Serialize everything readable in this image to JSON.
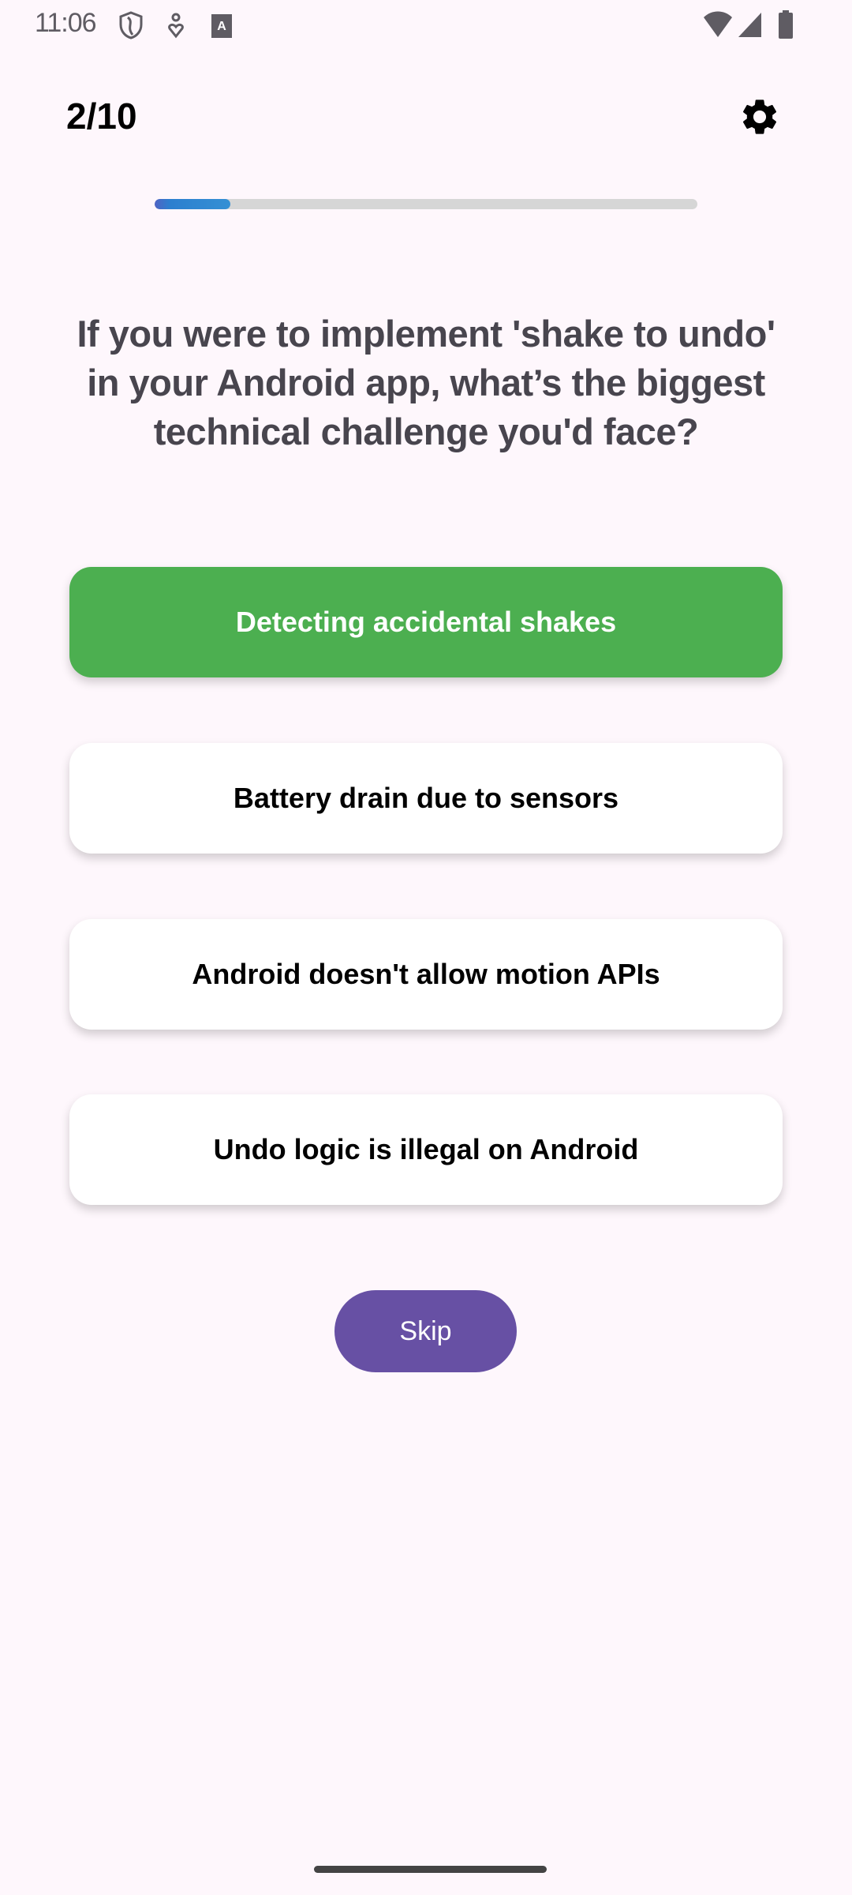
{
  "status_bar": {
    "time": "11:06",
    "left_icons": [
      "shield-icon",
      "accessibility-icon",
      "keyboard-a-icon"
    ],
    "right_icons": [
      "wifi-icon",
      "signal-icon",
      "battery-icon"
    ]
  },
  "header": {
    "counter": "2/10",
    "settings_icon": "gear-icon"
  },
  "progress": {
    "fraction": 0.14,
    "fill_color": "#2c7fcf",
    "track_color": "#d6d6d6"
  },
  "question": {
    "lines": [
      "If you were to implement 'shake to undo'",
      "in your Android app, what’s the biggest",
      "technical challenge you'd face?"
    ]
  },
  "options": [
    {
      "label": "Detecting accidental shakes",
      "state": "correct",
      "color": "#4caf50"
    },
    {
      "label": "Battery drain due to sensors",
      "state": "default"
    },
    {
      "label": "Android doesn't allow motion APIs",
      "state": "default"
    },
    {
      "label": "Undo logic is illegal on Android",
      "state": "default"
    }
  ],
  "skip": {
    "label": "Skip",
    "color": "#6750a4"
  }
}
